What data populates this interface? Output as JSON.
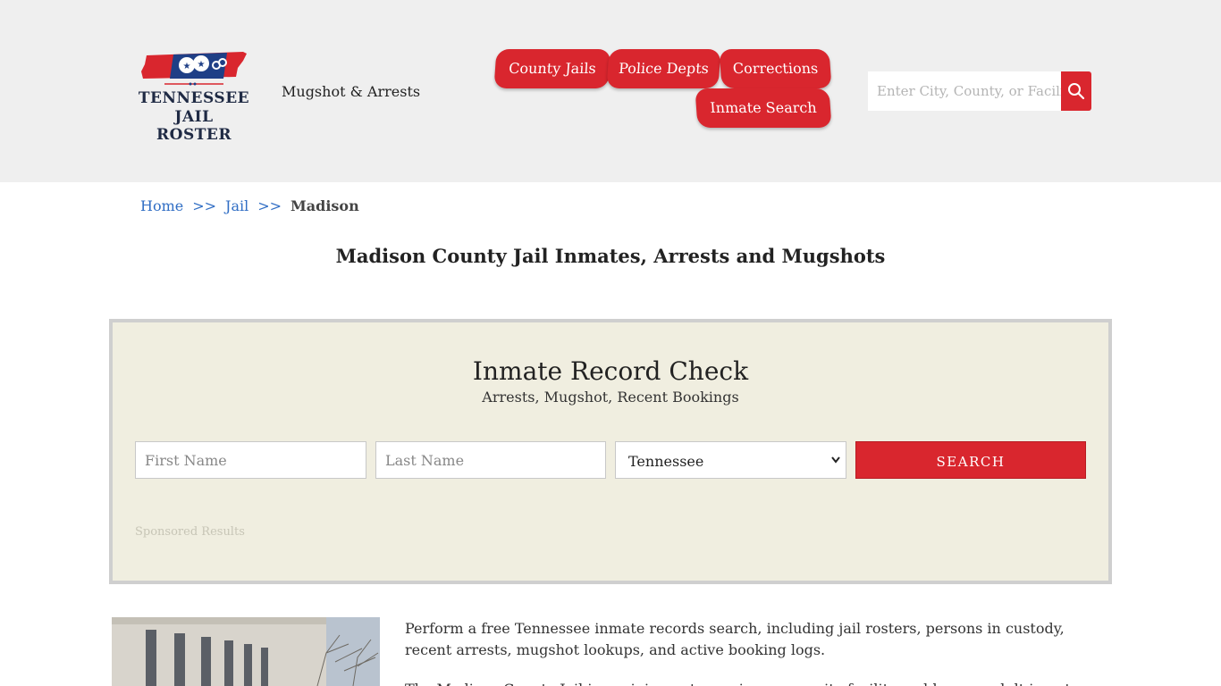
{
  "header": {
    "logo_line1": "TENNESSEE",
    "logo_line2": "JAIL ROSTER",
    "tagline": "Mugshot & Arrests",
    "nav": {
      "county_jails": "County Jails",
      "police_depts": "Police Depts",
      "corrections": "Corrections",
      "inmate_search": "Inmate Search"
    },
    "search": {
      "placeholder": "Enter City, County, or Facility"
    }
  },
  "breadcrumb": {
    "home": "Home",
    "sep": ">>",
    "jail": "Jail",
    "current": "Madison"
  },
  "page_title": "Madison County Jail Inmates, Arrests and Mugshots",
  "record_check": {
    "title": "Inmate Record Check",
    "subtitle": "Arrests, Mugshot, Recent Bookings",
    "first_name_placeholder": "First Name",
    "last_name_placeholder": "Last Name",
    "state_selected": "Tennessee",
    "search_label": "SEARCH",
    "sponsored": "Sponsored Results"
  },
  "content": {
    "intro": "Perform a free Tennessee inmate records search, including jail rosters, persons in custody, recent arrests, mugshot lookups, and active booking logs.",
    "intro2": "The Madison County Jail is a minimum to maximum security facility and houses adult inmates and"
  },
  "colors": {
    "accent_red": "#d9262e",
    "header_bg": "#efefef",
    "panel_bg": "#f0eee0",
    "link_blue": "#2f6dc4"
  }
}
